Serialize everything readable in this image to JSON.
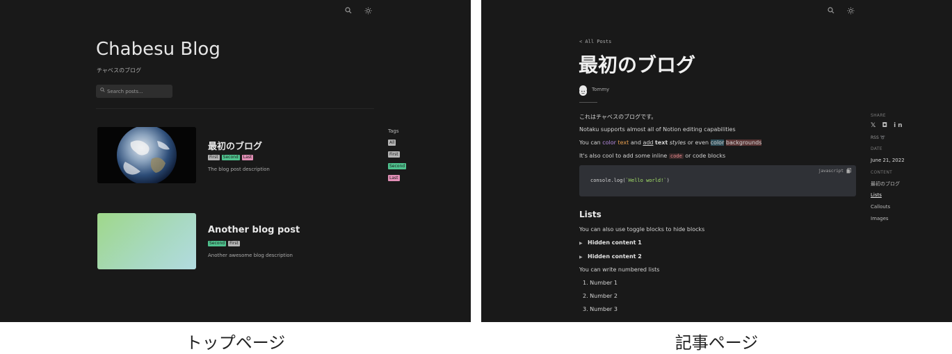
{
  "top_page": {
    "blog_title": "Chabesu Blog",
    "blog_subtitle": "チャベスのブログ",
    "search_placeholder": "Search posts...",
    "posts": [
      {
        "title": "最初のブログ",
        "tags": [
          "First",
          "Second",
          "Last"
        ],
        "description": "The blog post description"
      },
      {
        "title": "Another blog post",
        "tags": [
          "Second",
          "First"
        ],
        "description": "Another awesome blog description"
      }
    ],
    "tags_heading": "Tags",
    "tags": [
      "All",
      "First",
      "Second",
      "Last"
    ],
    "caption": "トップページ"
  },
  "article_page": {
    "back_link": "< All Posts",
    "title": "最初のブログ",
    "author": "Tommy",
    "paragraphs": {
      "p1": "これはチャベスのブログです。",
      "p2": "Notaku supports almost all of Notion editing capabilities",
      "p3_parts": [
        "You can ",
        "color",
        " ",
        "text",
        " and ",
        "add",
        " ",
        "text",
        " ",
        "styles",
        " or even ",
        "color",
        " ",
        "backgrounds"
      ],
      "p4_before": "It's also cool to add some inline ",
      "p4_code": "code",
      "p4_after": " or code blocks"
    },
    "code_block": {
      "language": "javascript",
      "code_prefix": "console.log(",
      "code_string": "`Hello world!`",
      "code_suffix": ")"
    },
    "lists_heading": "Lists",
    "toggle_intro": "You can also use toggle blocks to hide blocks",
    "toggles": [
      "Hidden content 1",
      "Hidden content 2"
    ],
    "numbered_intro": "You can write numbered lists",
    "numbered_items": [
      "1. Number 1",
      "2. Number 2",
      "3. Number 3"
    ],
    "sidebar": {
      "share_label": "SHARE",
      "share_icons": "𝕏 ◘ in",
      "rss_label": "RSS ➰",
      "date_label": "DATE",
      "date_value": "June 21, 2022",
      "content_label": "CONTENT",
      "content_links": [
        "最初のブログ",
        "Lists",
        "Callouts",
        "Images"
      ]
    },
    "caption": "記事ページ"
  },
  "colors": {
    "panel_bg": "#191919",
    "tag_gray": "#b5b5b5",
    "tag_green": "#4fc28e",
    "tag_pink": "#e28fb6",
    "code_bg": "#2f3136"
  }
}
